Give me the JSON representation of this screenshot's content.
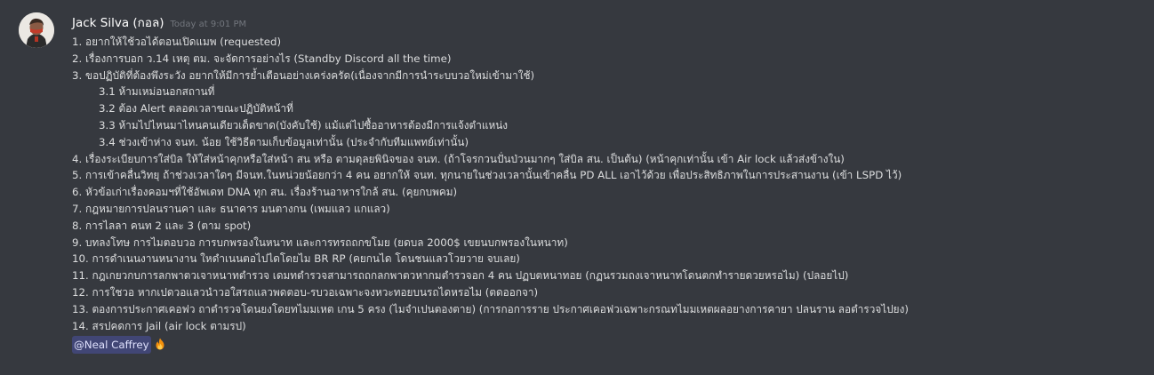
{
  "message": {
    "author": "Jack Silva (กอล)",
    "timestamp": "Today at 9:01 PM",
    "lines": [
      {
        "text": "1. อยากให้ใช้วอได้ตอนเปิดแมพ (requested)",
        "indent": false
      },
      {
        "text": "2. เรื่องการบอก ว.14 เหตุ ตม. จะจัดการอย่างไร (Standby Discord all the time)",
        "indent": false
      },
      {
        "text": "3. ขอปฏิบัติที่ต้องพึงระวัง อยากให้มีการย้ำเตือนอย่างเคร่งครัด(เนื่องจากมีการนำระบบวอใหม่เข้ามาใช้)",
        "indent": false
      },
      {
        "text": "3.1 ห้ามเหม่อนอกสถานที่",
        "indent": true
      },
      {
        "text": "3.2 ต้อง Alert ตลอดเวลาขณะปฏิบัติหน้าที่",
        "indent": true
      },
      {
        "text": "3.3 ห้ามไปไหนมาไหนคนเดียวเด็ดขาด(บังคับใช้) แม้แต่ไปซื้ออาหารต้องมีการแจ้งตำแหน่ง",
        "indent": true
      },
      {
        "text": "3.4 ช่วงเข้าห่าง จนท. น้อย ใช้วิธีตามเก็บข้อมูลเท่านั้น (ประจำกับทีมแพทย์เท่านั้น)",
        "indent": true
      },
      {
        "text": "4. เรื่องระเบียบการใส่บิล ให้ใส่หน้าคุกหรือใส่หน้า สน หรือ ตามดุลยพินิจของ จนท. (ถ้าโจรกวนปั่นป่วนมากๆ ใส่บิล สน. เป็นต้น) (หน้าคุกเท่านั้น เข้า Air lock แล้วส่งข้างใน)",
        "indent": false
      },
      {
        "text": "5. การเข้าคลื่นวิทยุ ถ้าช่วงเวลาใดๆ มีจนท.ในหน่วยน้อยกว่า 4 คน อยากให้ จนท. ทุกนายในช่วงเวลานั้นเข้าคลื่น PD ALL เอาไว้ด้วย เพื่อประสิทธิภาพในการประสานงาน (เข้า LSPD ไว้)",
        "indent": false
      },
      {
        "text": "6. หัวข้อเก่าเรื่องคอมฯที่ใช้อัพเดท DNA ทุก สน. เรื่องร้านอาหารใกล้ สน. (คุยกบพคม)",
        "indent": false
      },
      {
        "text": "7. กฎหมายการปลนรานคา และ ธนาคาร มนตางกน (เพมแลว แกแลว)",
        "indent": false
      },
      {
        "text": "8. การไลลา คนท 2 และ 3 (ตาม spot)",
        "indent": false
      },
      {
        "text": "9. บทลงโทษ การไมตอบวอ การบกพรองในหนาท และการทรถถกขโมย (ยดบล 2000$ เขยนบกพรองในหนาท)",
        "indent": false
      },
      {
        "text": "10. การดำเนนงานหนางาน ใหดำเนนตอไปไดโดยไม BR RP (คยกนได โดนชนแลวโวยวาย จบเลย)",
        "indent": false
      },
      {
        "text": "11. กฎเกยวกบการลกพาตวเจาหนาทตำรวจ เดมทตำรวจสามารถถกลกพาตวหากมตำรวจอก 4 คน ปฏบตหนาทอย (กฏนรวมถงเจาหนาทโดนตกทำรายดวยหรอไม) (ปลอยไป)",
        "indent": false
      },
      {
        "text": "12. การใชวอ หากเปดวอแลวนำวอใสรถแลวพดตอบ-รบวอเฉพาะจงหวะทอยบนรถไดหรอไม (ตดออกจา)",
        "indent": false
      },
      {
        "text": "13. ตองการประกาศเคอฟว ถาตำรวจโดนยงโดยทไมมเหต เกน 5 ครง (ไมจำเปนตองตาย) (การกอการราย ประกาศเคอฟวเฉพาะกรณทไมมเหตผลอยางการคายา ปลนราน ลอตำรวจไปยง)",
        "indent": false
      },
      {
        "text": "14. สรปคดการ Jail (air lock ตามรป)",
        "indent": false
      }
    ],
    "mention": "@Neal Caffrey",
    "emoji": "fire-emoji"
  },
  "colors": {
    "background": "#36393f",
    "text": "#dcddde",
    "author": "#ffffff",
    "timestamp": "#72767d",
    "mention_bg": "#414675",
    "mention_text": "#dee0fc"
  }
}
